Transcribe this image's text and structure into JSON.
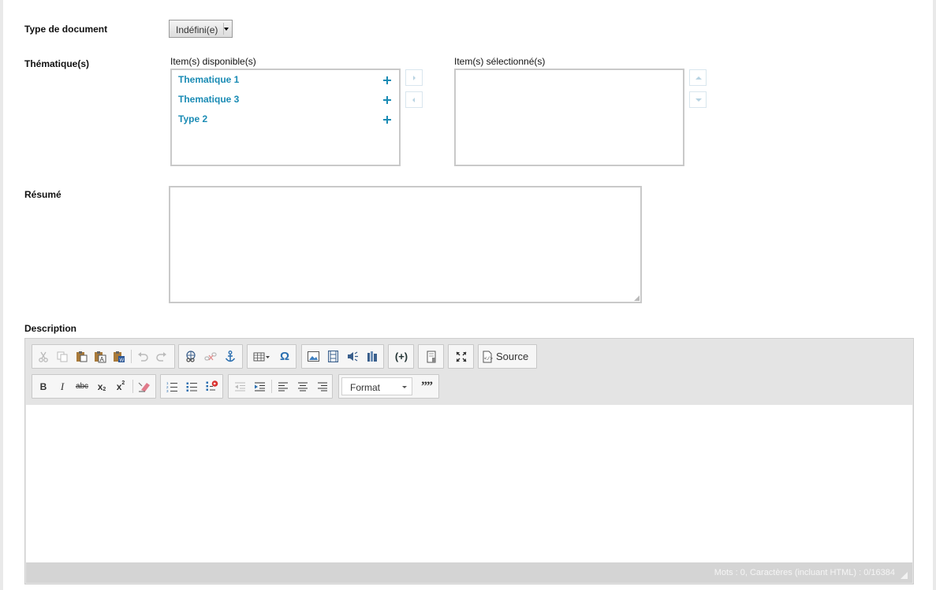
{
  "form": {
    "type_label": "Type de document",
    "type_value": "Indéfini(e)",
    "thematique_label": "Thématique(s)",
    "available_caption": "Item(s) disponible(s)",
    "selected_caption": "Item(s) sélectionné(s)",
    "available_items": [
      "Thematique 1",
      "Thematique 3",
      "Type 2"
    ],
    "resume_label": "Résumé",
    "description_label": "Description"
  },
  "editor": {
    "source_label": "Source",
    "format_label": "Format",
    "bold": "B",
    "italic": "I",
    "strike": "abc",
    "subscript": "x",
    "superscript": "x",
    "omega": "Ω",
    "placeholder_btn": "(+)",
    "quote": "99",
    "status": "Mots : 0, Caractères (incluant HTML) : 0/16384"
  },
  "icons": {
    "toolbar_row1": [
      "cut-icon",
      "copy-icon",
      "paste-icon",
      "paste-text-icon",
      "paste-word-icon",
      "undo-icon",
      "redo-icon",
      "link-icon",
      "unlink-icon",
      "anchor-icon",
      "table-icon",
      "special-char-icon",
      "image-icon",
      "video-icon",
      "audio-icon",
      "library-icon",
      "placeholder-icon",
      "template-icon",
      "maximize-icon",
      "source-icon"
    ],
    "toolbar_row2": [
      "bold-icon",
      "italic-icon",
      "strike-icon",
      "subscript-icon",
      "superscript-icon",
      "remove-format-icon",
      "numbered-list-icon",
      "bulleted-list-icon",
      "checklist-icon",
      "outdent-icon",
      "indent-icon",
      "align-left-icon",
      "align-center-icon",
      "align-right-icon",
      "format-dropdown",
      "blockquote-icon"
    ]
  },
  "colors": {
    "link": "#1a8bb4",
    "accent_icon": "#2b6fb0"
  }
}
